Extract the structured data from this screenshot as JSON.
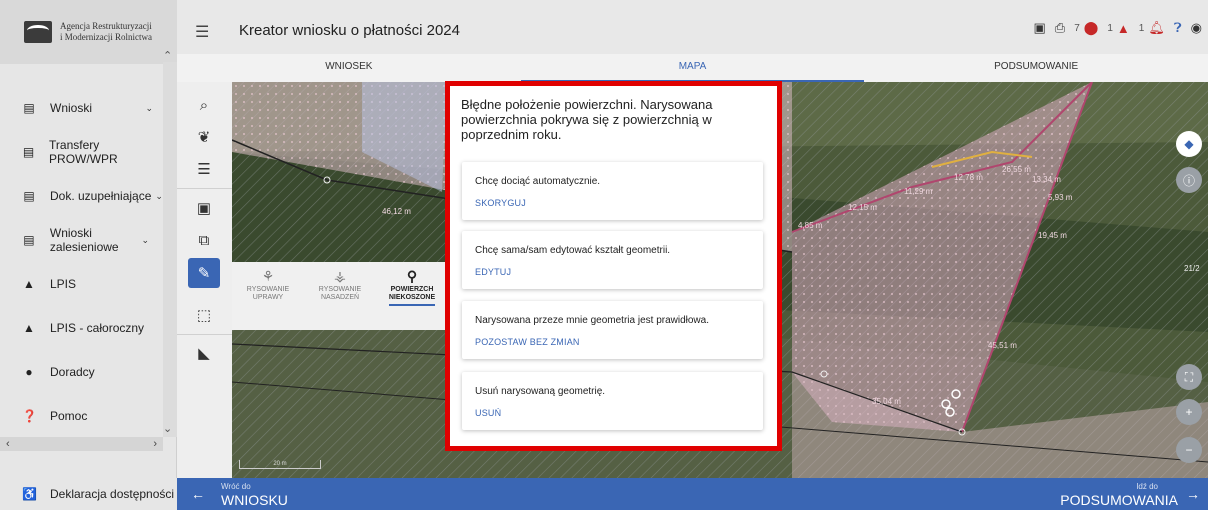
{
  "logo": {
    "line1": "Agencja Restrukturyzacji",
    "line2": "i Modernizacji Rolnictwa"
  },
  "sidebar": {
    "items": [
      {
        "icon": "document-icon",
        "label": "Wnioski",
        "caret": "⌄"
      },
      {
        "icon": "document-icon",
        "label": "Transfery PROW/WPR",
        "caret": ""
      },
      {
        "icon": "document-icon",
        "label": "Dok. uzupełniające",
        "caret": "⌄"
      },
      {
        "icon": "document-icon",
        "label": "Wnioski zalesieniowe",
        "caret": "⌄"
      },
      {
        "icon": "mountain-icon",
        "label": "LPIS",
        "caret": ""
      },
      {
        "icon": "mountain-icon",
        "label": "LPIS - całoroczny",
        "caret": ""
      },
      {
        "icon": "person-icon",
        "label": "Doradcy",
        "caret": ""
      },
      {
        "icon": "help-icon",
        "label": "Pomoc",
        "caret": ""
      }
    ],
    "footer": "Deklaracja dostępności"
  },
  "header": {
    "title": "Kreator wniosku o płatności 2024",
    "counts": {
      "info": "7",
      "errors": "1",
      "warnings": "1"
    }
  },
  "tabs": [
    {
      "label": "WNIOSEK",
      "active": false
    },
    {
      "label": "MAPA",
      "active": true
    },
    {
      "label": "PODSUMOWANIE",
      "active": false
    }
  ],
  "modes": [
    {
      "line1": "RYSOWANIE",
      "line2": "UPRAWY",
      "active": false
    },
    {
      "line1": "RYSOWANIE",
      "line2": "NASADZEŃ",
      "active": false
    },
    {
      "line1": "POWIERZCH",
      "line2": "NIEKOSZONE",
      "active": true
    }
  ],
  "map": {
    "labels": [
      "46,12 m",
      "12,78 m",
      "11,29 m",
      "12,15 m",
      "26,55 m",
      "13,34 m",
      "4,85 m",
      "5,93 m",
      "19,45 m",
      "45,51 m",
      "35,04 m"
    ],
    "scale": "20 m",
    "side_label": "21/2"
  },
  "dialog": {
    "title": "Błędne położenie powierzchni. Narysowana powierzchnia pokrywa się z powierzchnią w poprzednim roku.",
    "options": [
      {
        "text": "Chcę dociąć automatycznie.",
        "action": "SKORYGUJ"
      },
      {
        "text": "Chcę sama/sam edytować kształt geometrii.",
        "action": "EDYTUJ"
      },
      {
        "text": "Narysowana przeze mnie geometria jest prawidłowa.",
        "action": "POZOSTAW BEZ ZMIAN"
      },
      {
        "text": "Usuń narysowaną geometrię.",
        "action": "USUŃ"
      }
    ]
  },
  "footer_nav": {
    "back_small": "Wróć do",
    "back_big": "WNIOSKU",
    "next_small": "Idź do",
    "next_big": "PODSUMOWANIA"
  },
  "colors": {
    "accent": "#3a66b4",
    "highlight": "#e00000"
  }
}
